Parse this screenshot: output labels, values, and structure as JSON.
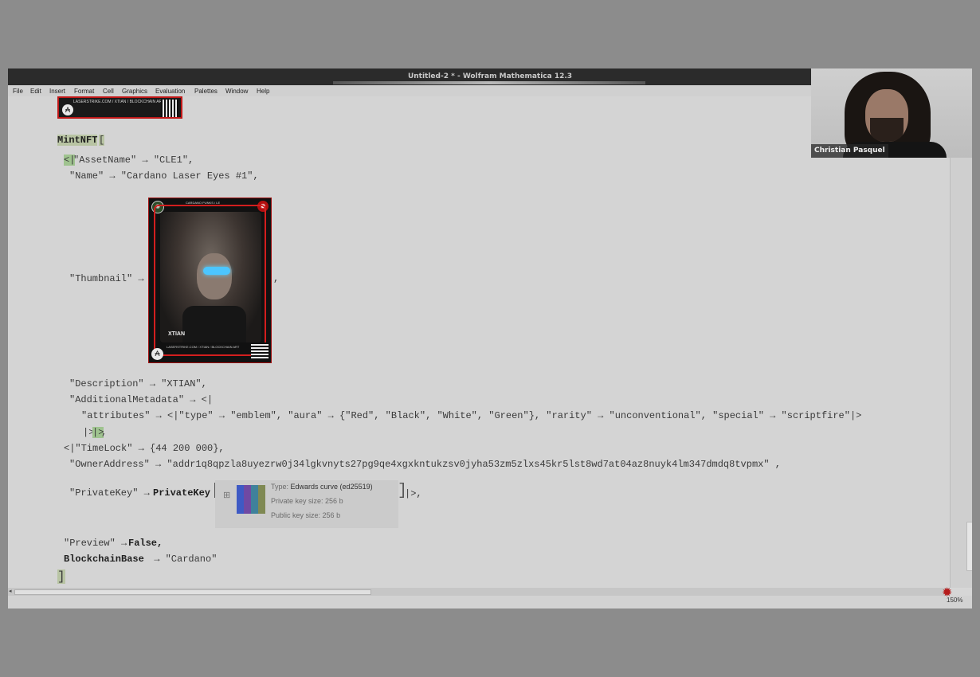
{
  "window": {
    "title": "Untitled-2 * - Wolfram Mathematica 12.3"
  },
  "menu": [
    "File",
    "Edit",
    "Insert",
    "Format",
    "Cell",
    "Graphics",
    "Evaluation",
    "Palettes",
    "Window",
    "Help"
  ],
  "code": {
    "func": "MintNFT",
    "open_bracket": "[",
    "l_open": "<|",
    "asset_line": "\"AssetName\" → \"CLE1\",",
    "name_line": "\"Name\" → \"Cardano Laser Eyes #1\",",
    "thumb_key": "\"Thumbnail\" →",
    "comma": ",",
    "desc_line": "\"Description\" → \"XTIAN\",",
    "addmeta_line": "\"AdditionalMetadata\" → <|",
    "attr_line": "\"attributes\" → <|\"type\" → \"emblem\", \"aura\" → {\"Red\", \"Black\", \"White\", \"Green\"}, \"rarity\" → \"unconventional\", \"special\" → \"scriptfire\"|>",
    "close_a": "|>",
    "close_b": "|>",
    "close_comma": ",",
    "timelock_line": "<|\"TimeLock\" → {44 200 000},",
    "owner_line": "\"OwnerAddress\" → \"addr1q8qpzla8uyezrw0j34lgkvnyts27pg9qe4xgxkntukzsv0jyha53zm5zlxs45kr5lst8wd7at04az8nuyk4lm347dmdq8tvpmx\" ,",
    "pk_key": "\"PrivateKey\" →",
    "pk_head": "PrivateKey",
    "pk_tail": "|>,",
    "preview_key": "\"Preview\" →",
    "preview_val": "False,",
    "chain_key": "BlockchainBase",
    "chain_val": " → \"Cardano\"",
    "close_bracket": "]"
  },
  "private_key": {
    "type_label": "Type:",
    "type_value": "Edwards curve (ed25519)",
    "priv_label": "Private key size:",
    "priv_value": "256 b",
    "pub_label": "Public key size:",
    "pub_value": "256 b"
  },
  "nft_card": {
    "header": "CARDANO PUNKS / LE",
    "name": "XTIAN",
    "url": "LASERSTRIKE.COM / XTIAN / BLOCKCHAIN ART"
  },
  "top_card": {
    "caption": "LASERSTRIKE.COM / XTIAN / BLOCKCHAIN ART"
  },
  "status": {
    "zoom": "150%"
  },
  "webcam": {
    "name": "Christian Pasquel"
  },
  "icons": {
    "spikey": "wolfram-spikey-icon",
    "cardano": "cardano-logo-icon",
    "qr": "qr-code-icon"
  }
}
